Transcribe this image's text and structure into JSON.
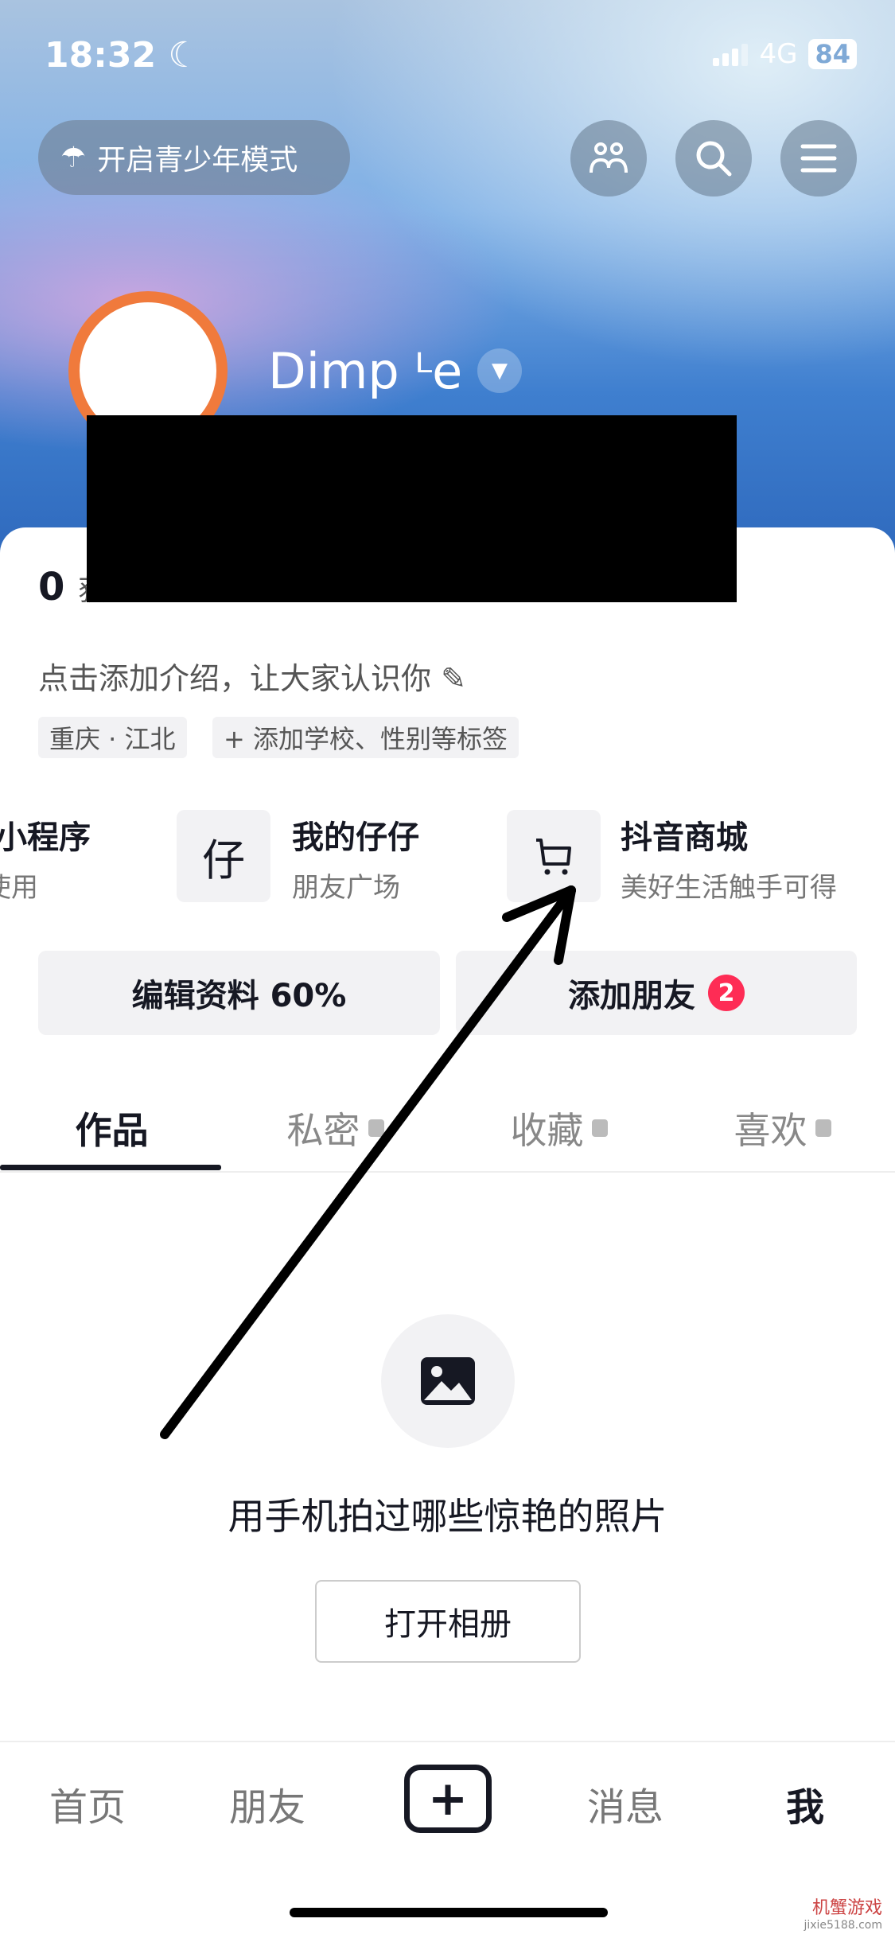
{
  "status": {
    "time": "18:32",
    "network": "4G",
    "battery": "84"
  },
  "header": {
    "teen_mode": "开启青少年模式"
  },
  "profile": {
    "name": "Dimp ᴸe",
    "stat_prefix": "0",
    "stat_label": "获",
    "intro": "点击添加介绍，让大家认识你",
    "tags": [
      "重庆 · 江北",
      "+ 添加学校、性别等标签"
    ]
  },
  "services": [
    {
      "title": "小程序",
      "sub": "使用"
    },
    {
      "title": "我的仔仔",
      "sub": "朋友广场",
      "icon_text": "仔"
    },
    {
      "title": "抖音商城",
      "sub": "美好生活触手可得"
    }
  ],
  "actions": {
    "edit": "编辑资料 60%",
    "add_friend": "添加朋友",
    "add_friend_badge": "2"
  },
  "tabs": [
    "作品",
    "私密",
    "收藏",
    "喜欢"
  ],
  "empty": {
    "text": "用手机拍过哪些惊艳的照片",
    "button": "打开相册"
  },
  "nav": [
    "首页",
    "朋友",
    "消息",
    "我"
  ],
  "watermark": {
    "text": "机蟹游戏",
    "url": "jixie5188.com"
  },
  "colors": {
    "accent": "#fe2c55",
    "text": "#161823"
  }
}
